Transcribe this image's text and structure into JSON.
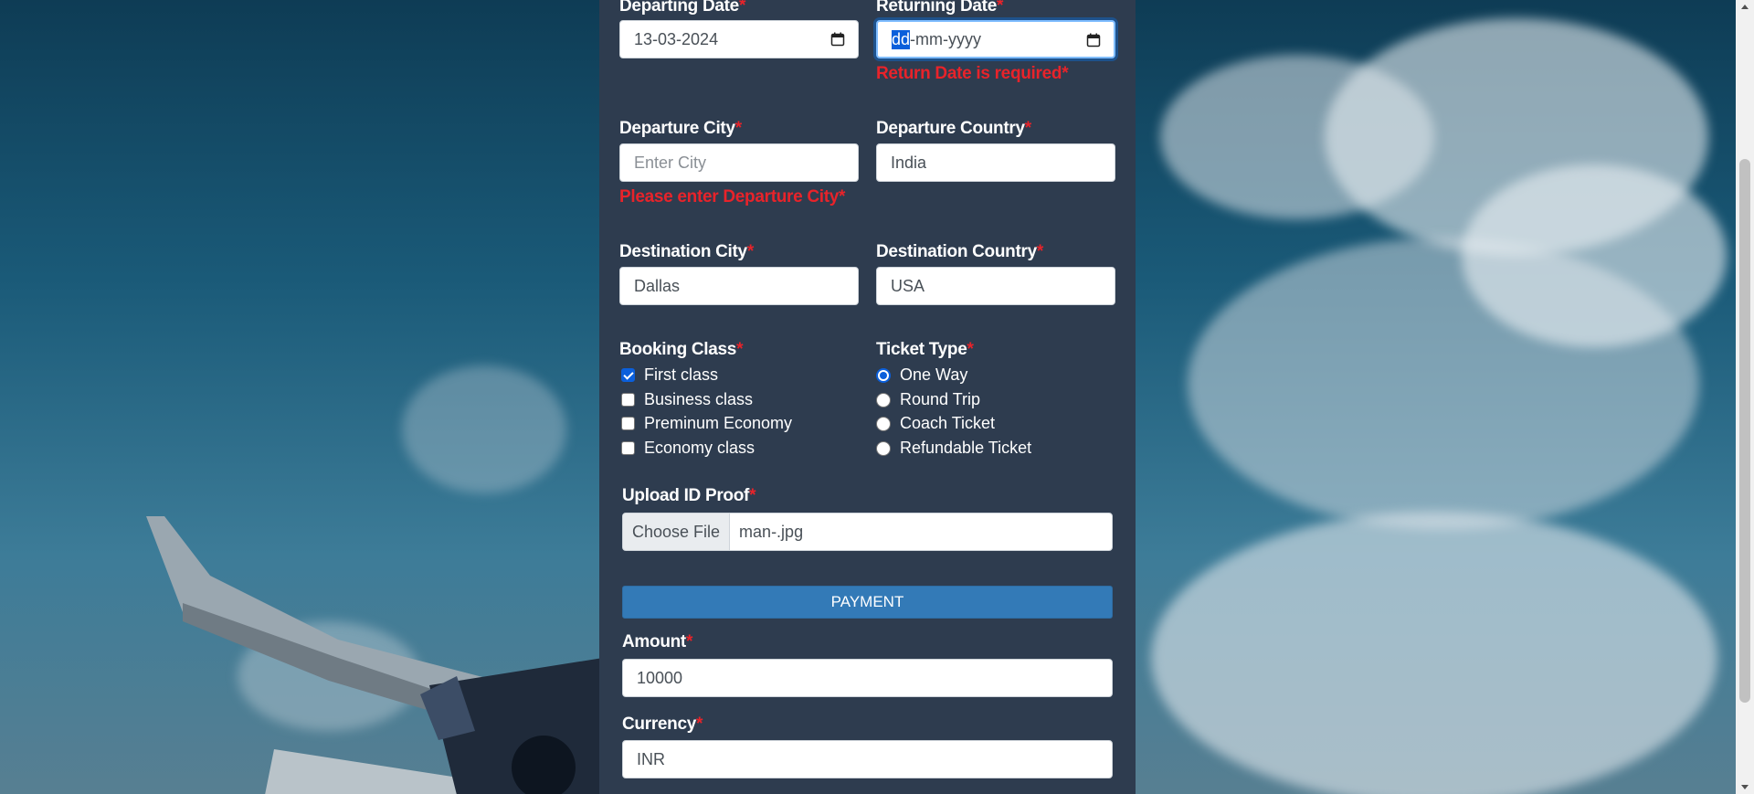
{
  "form": {
    "departing_date": {
      "label": "Departing Date",
      "required_mark": "*",
      "value": "13-03-2024"
    },
    "returning_date": {
      "label": "Returning Date",
      "required_mark": "*",
      "value_selected": "dd",
      "value_rest": "-mm-yyyy",
      "error": "Return Date is required*"
    },
    "departure_city": {
      "label": "Departure City",
      "required_mark": "*",
      "placeholder": "Enter City",
      "error": "Please enter Departure City*"
    },
    "departure_country": {
      "label": "Departure Country",
      "required_mark": "*",
      "value": "India"
    },
    "destination_city": {
      "label": "Destination City",
      "required_mark": "*",
      "value": "Dallas"
    },
    "destination_country": {
      "label": "Destination Country",
      "required_mark": "*",
      "value": "USA"
    },
    "booking_class": {
      "label": "Booking Class",
      "required_mark": "*",
      "options": [
        {
          "label": "First class",
          "checked": true
        },
        {
          "label": "Business class",
          "checked": false
        },
        {
          "label": "Preminum Economy",
          "checked": false
        },
        {
          "label": "Economy class",
          "checked": false
        }
      ]
    },
    "ticket_type": {
      "label": "Ticket Type",
      "required_mark": "*",
      "options": [
        {
          "label": "One Way",
          "checked": true
        },
        {
          "label": "Round Trip",
          "checked": false
        },
        {
          "label": "Coach Ticket",
          "checked": false
        },
        {
          "label": "Refundable Ticket",
          "checked": false
        }
      ]
    },
    "id_proof": {
      "label": "Upload ID Proof",
      "required_mark": "*",
      "button_label": "Choose File",
      "file_name": "man-.jpg"
    },
    "payment_button": "PAYMENT",
    "amount": {
      "label": "Amount",
      "required_mark": "*",
      "value": "10000"
    },
    "currency": {
      "label": "Currency",
      "required_mark": "*",
      "value": "INR"
    }
  },
  "colors": {
    "panel": "#2e3c4f",
    "error": "#e8232a",
    "button": "#337ab7",
    "checked": "#0b5fdb"
  }
}
